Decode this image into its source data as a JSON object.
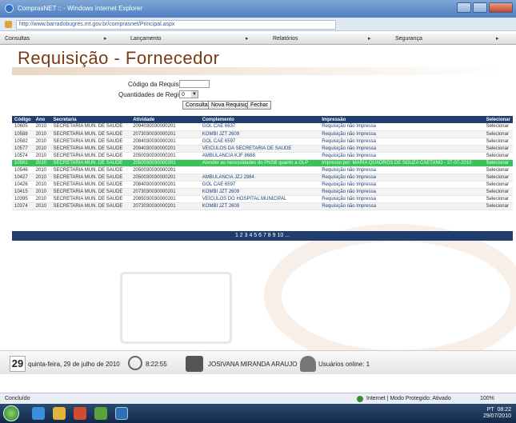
{
  "window": {
    "title": "ComprasNET :: - Windows Internet Explorer",
    "url": "http://www.barradobugres.mt.gov.br/comprasnet/Principal.aspx"
  },
  "menu": [
    "Consultas",
    "Lançamento",
    "Relatórios",
    "Segurança"
  ],
  "page": {
    "title": "Requisição - Fornecedor"
  },
  "form": {
    "code_label": "Código da Requisição:",
    "qty_label": "Quantidades de Registros:",
    "qty_value": "0",
    "btn_consultar": "Consultar",
    "btn_nova": "Nova Requisição",
    "btn_fechar": "Fechar"
  },
  "grid": {
    "headers": [
      "Código",
      "Ano",
      "Secretaria",
      "Atividade",
      "Complemento",
      "Impressão",
      "Selecionar"
    ],
    "rows": [
      {
        "codigo": "10605",
        "ano": "2010",
        "secretaria": "SECRETARIA MUN. DE SAUDE",
        "atividade": "2094030030000201",
        "complemento": "GOL CAE 6637",
        "impressao": "Requisição não Impressa",
        "acao": "Selecionar"
      },
      {
        "codigo": "10588",
        "ano": "2010",
        "secretaria": "SECRETARIA MUN. DE SAUDE",
        "atividade": "2073030030000201",
        "complemento": "KOMBI JZT 2609",
        "impressao": "Requisição não Impressa",
        "acao": "Selecionar"
      },
      {
        "codigo": "10582",
        "ano": "2010",
        "secretaria": "SECRETARIA MUN. DE SAUDE",
        "atividade": "2084030030000201",
        "complemento": "GOL CAE 6597",
        "impressao": "Requisição não Impressa",
        "acao": "Selecionar"
      },
      {
        "codigo": "10577",
        "ano": "2010",
        "secretaria": "SECRETARIA MUN. DE SAUDE",
        "atividade": "2094030030000201",
        "complemento": "VEICULOS DA SECRETARIA DE SAUDE",
        "impressao": "Requisição não Impressa",
        "acao": "Selecionar"
      },
      {
        "codigo": "10574",
        "ano": "2010",
        "secretaria": "SECRETARIA MUN. DE SAUDE",
        "atividade": "2050030030000201",
        "complemento": "AMBULANCIA KJF 8688",
        "impressao": "Requisição não Impressa",
        "acao": "Selecionar"
      },
      {
        "codigo": "10561",
        "ano": "2010",
        "secretaria": "SECRETARIA MUN. DE SAUDE",
        "atividade": "2050030030000201",
        "complemento": "Atender as necessidades do PNSB quanto a GLP",
        "impressao": "Impresso por: MARIA QUADROS DE SOUZA CAETANO - 27-07-2010",
        "acao": "Selecionar"
      },
      {
        "codigo": "10546",
        "ano": "2010",
        "secretaria": "SECRETARIA MUN. DE SAUDE",
        "atividade": "2050030030000201",
        "complemento": "",
        "impressao": "Requisição não Impressa",
        "acao": "Selecionar"
      },
      {
        "codigo": "10427",
        "ano": "2010",
        "secretaria": "SECRETARIA MUN. DE SAUDE",
        "atividade": "2050030030000201",
        "complemento": "AMBULANCIA JZJ 2984",
        "impressao": "Requisição não Impressa",
        "acao": "Selecionar"
      },
      {
        "codigo": "10426",
        "ano": "2010",
        "secretaria": "SECRETARIA MUN. DE SAUDE",
        "atividade": "2084030030000201",
        "complemento": "GOL CAE 6597",
        "impressao": "Requisição não Impressa",
        "acao": "Selecionar"
      },
      {
        "codigo": "10415",
        "ano": "2010",
        "secretaria": "SECRETARIA MUN. DE SAUDE",
        "atividade": "2073030030000201",
        "complemento": "KOMBI JZT 2609",
        "impressao": "Requisição não Impressa",
        "acao": "Selecionar"
      },
      {
        "codigo": "10395",
        "ano": "2010",
        "secretaria": "SECRETARIA MUN. DE SAUDE",
        "atividade": "2085030030000201",
        "complemento": "VEICULOS DO HOSPITAL MUNICIPAL",
        "impressao": "Requisição não Impressa",
        "acao": "Selecionar"
      },
      {
        "codigo": "10374",
        "ano": "2010",
        "secretaria": "SECRETARIA MUN. DE SAUDE",
        "atividade": "2073030030000201",
        "complemento": "KOMBI JZT 2609",
        "impressao": "Requisição não Impressa",
        "acao": "Selecionar"
      }
    ],
    "selected_index": 5,
    "pager": "1 2 3 4 5 6 7 8 9 10 ..."
  },
  "info": {
    "day": "29",
    "date": "quinta-feira, 29 de julho de 2010",
    "time": "8:22:55",
    "user": "JOSIVANA MIRANDA ARAUJO",
    "online": "Usuários online: 1"
  },
  "statusbar": {
    "left": "Concluído",
    "zone": "Internet | Modo Protegido: Ativado",
    "zoom": "100%"
  },
  "taskbar": {
    "lang": "PT",
    "clock": "08:22",
    "date": "29/07/2010"
  },
  "colors": {
    "title_brown": "#7a3a12",
    "grid_header": "#1f3e6e",
    "selected_row": "#3cc15a"
  }
}
